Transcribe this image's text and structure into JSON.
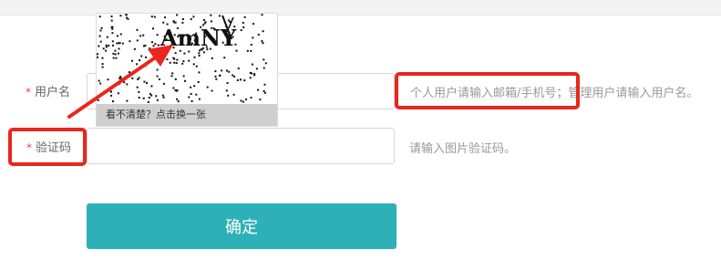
{
  "form": {
    "username": {
      "required_mark": "*",
      "label": "用户名",
      "value": "",
      "hint": "个人用户请输入邮箱/手机号；管理用户请输入用户名。"
    },
    "captcha": {
      "required_mark": "*",
      "label": "验证码",
      "value": "",
      "hint": "请输入图片验证码。",
      "image_text": "AmNY",
      "refresh_text": "看不清楚？点击换一张"
    },
    "submit_label": "确定"
  },
  "colors": {
    "accent_button": "#2eb0b8",
    "highlight": "#e8271d",
    "required": "#e8453c"
  }
}
